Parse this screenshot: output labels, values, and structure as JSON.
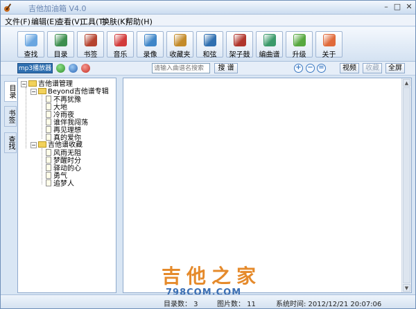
{
  "window": {
    "title": "吉他加油箱 V4.0",
    "minimize": "–",
    "maximize": "□",
    "close": "✕"
  },
  "menu": [
    {
      "label": "文件(F)"
    },
    {
      "label": "编辑(E)"
    },
    {
      "label": "查看(V)"
    },
    {
      "label": "工具(T)"
    },
    {
      "label": "换肤(K)"
    },
    {
      "label": "帮助(H)"
    }
  ],
  "toolbar": [
    {
      "label": "查找",
      "icon": "magnifier-icon",
      "color": "#6aa6e0"
    },
    {
      "label": "目录",
      "icon": "books-icon",
      "color": "#3d8f4f"
    },
    {
      "label": "书签",
      "icon": "bookmark-icon",
      "color": "#b5432f"
    },
    {
      "label": "音乐",
      "icon": "music-note-icon",
      "color": "#d23b3b"
    },
    {
      "label": "录像",
      "icon": "video-icon",
      "color": "#3f86c8"
    },
    {
      "label": "收藏夹",
      "icon": "favorites-icon",
      "color": "#c38b2a"
    },
    {
      "label": "和弦",
      "icon": "chord-icon",
      "color": "#2f6fb0"
    },
    {
      "label": "架子鼓",
      "icon": "drum-icon",
      "color": "#b0352c"
    },
    {
      "label": "编曲谱",
      "icon": "compose-icon",
      "color": "#3b9a6a"
    },
    {
      "label": "升级",
      "icon": "upgrade-icon",
      "color": "#56a83f"
    },
    {
      "label": "关于",
      "icon": "home-icon",
      "color": "#e06a3a"
    }
  ],
  "subbar": {
    "mp3_label": "mp3播放器",
    "search_placeholder": "请输入曲谱名搜索",
    "search_button": "搜 谱",
    "zoom_in": "+",
    "zoom_out": "−",
    "zoom_reset": "=",
    "video_button": "视频",
    "favorite_button": "收藏",
    "fullscreen_button": "全屏"
  },
  "side_tabs": [
    {
      "label": "目录"
    },
    {
      "label": "书签"
    },
    {
      "label": "查找"
    }
  ],
  "tree": {
    "root": "吉他谱管理",
    "groups": [
      {
        "label": "Beyond吉他谱专辑",
        "items": [
          "不再犹豫",
          "大地",
          "冷雨夜",
          "谁伴我闯荡",
          "再见理想",
          "真的爱你"
        ]
      },
      {
        "label": "吉他谱收藏",
        "items": [
          "风雨无阻",
          "梦醒时分",
          "驿动的心",
          "勇气",
          "追梦人"
        ]
      }
    ]
  },
  "watermark": {
    "main": "吉他之家",
    "sub": "798COM.COM"
  },
  "status": {
    "catalog": "目录数：   3",
    "images": "图片数：  11",
    "time": "系统时间:   2012/12/21 20:07:06"
  }
}
